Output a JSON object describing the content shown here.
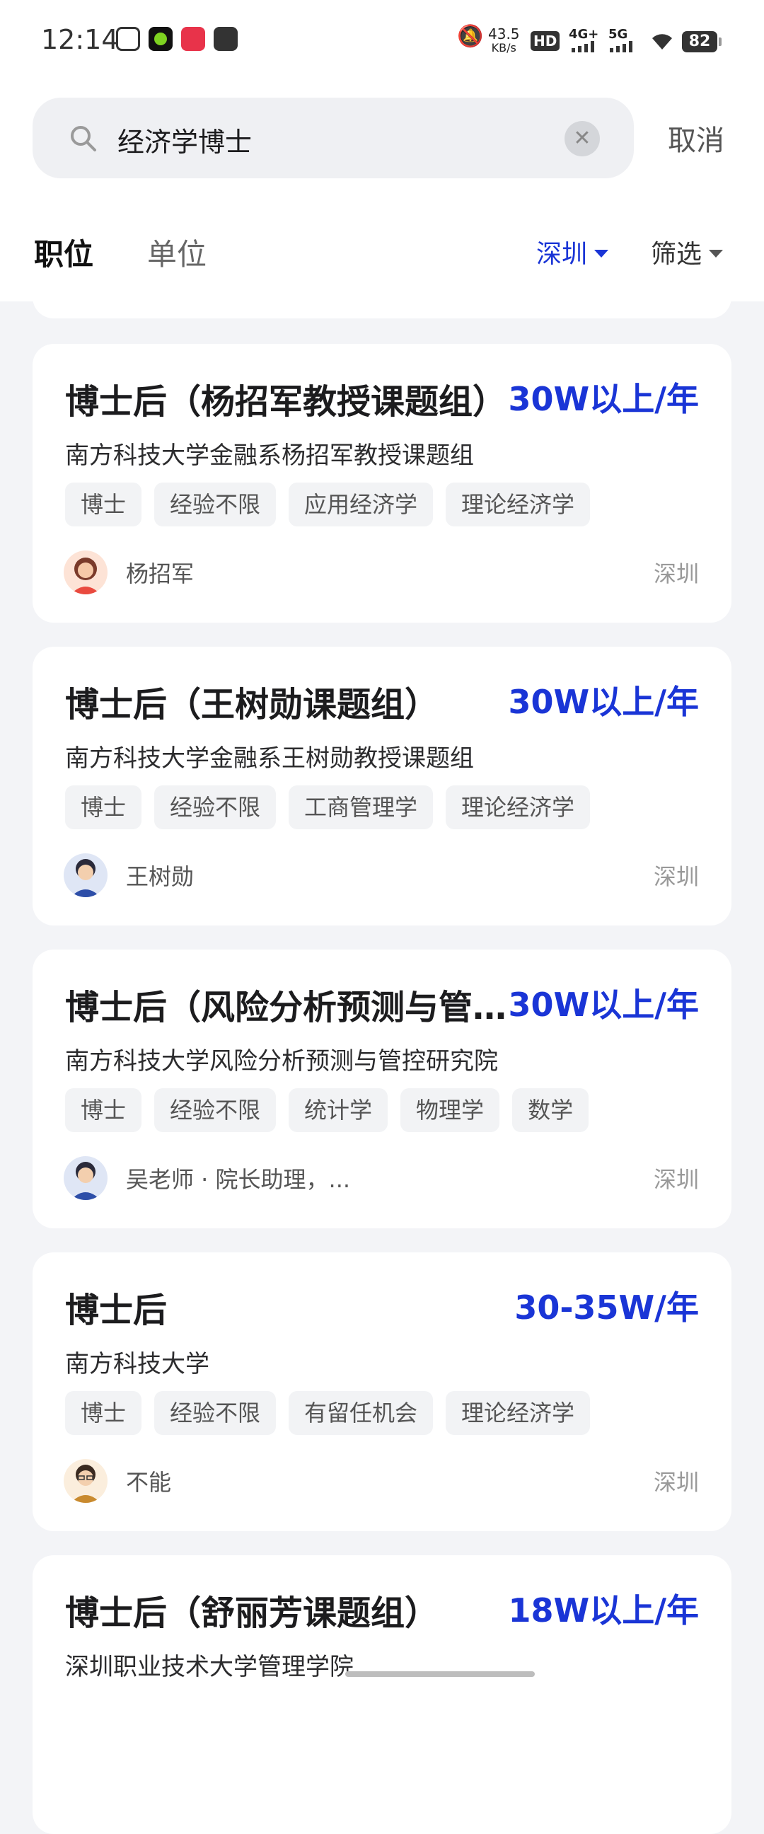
{
  "status_bar": {
    "time": "12:14",
    "net_speed": "43.5",
    "net_unit": "KB/s",
    "hd": "HD",
    "sig1": "4G+",
    "sig2": "5G",
    "battery": "82"
  },
  "search": {
    "query": "经济学博士",
    "cancel": "取消"
  },
  "tabs": [
    {
      "label": "职位"
    },
    {
      "label": "单位"
    }
  ],
  "filters": {
    "city": "深圳",
    "filter": "筛选"
  },
  "jobs": [
    {
      "title": "博士后（杨招军教授课题组）",
      "salary": "30W以上/年",
      "org": "南方科技大学金融系杨招军教授课题组",
      "tags": [
        "博士",
        "经验不限",
        "应用经济学",
        "理论经济学"
      ],
      "recruiter": "杨招军",
      "location": "深圳"
    },
    {
      "title": "博士后（王树勋课题组）",
      "salary": "30W以上/年",
      "org": "南方科技大学金融系王树勋教授课题组",
      "tags": [
        "博士",
        "经验不限",
        "工商管理学",
        "理论经济学"
      ],
      "recruiter": "王树勋",
      "location": "深圳"
    },
    {
      "title": "博士后（风险分析预测与管控研究院）",
      "salary": "30W以上/年",
      "org": "南方科技大学风险分析预测与管控研究院",
      "tags": [
        "博士",
        "经验不限",
        "统计学",
        "物理学",
        "数学"
      ],
      "recruiter": "吴老师 · 院长助理，...",
      "location": "深圳"
    },
    {
      "title": "博士后",
      "salary": "30-35W/年",
      "org": "南方科技大学",
      "tags": [
        "博士",
        "经验不限",
        "有留任机会",
        "理论经济学"
      ],
      "recruiter": "不能",
      "location": "深圳"
    },
    {
      "title": "博士后（舒丽芳课题组）",
      "salary": "18W以上/年",
      "org": "深圳职业技术大学管理学院",
      "tags": [],
      "recruiter": "",
      "location": ""
    }
  ]
}
